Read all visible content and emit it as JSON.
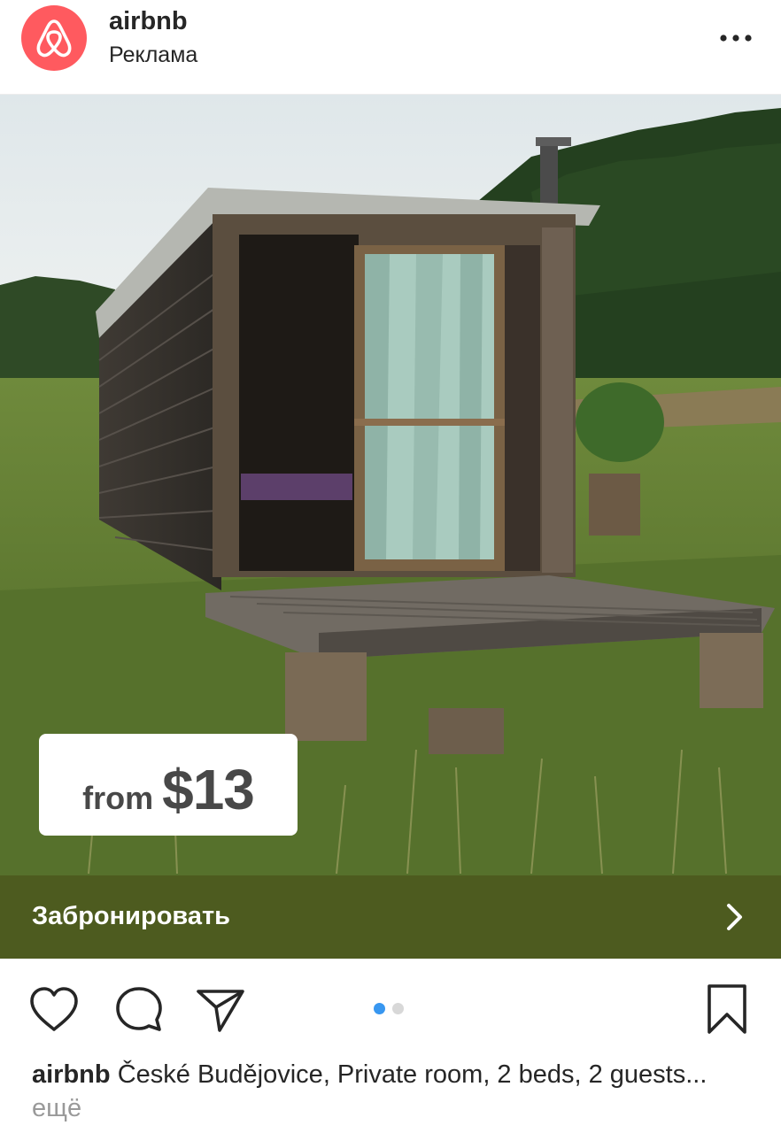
{
  "header": {
    "account_name": "airbnb",
    "sponsored_label": "Реклама",
    "avatar_icon": "airbnb-logo-icon",
    "more_icon": "more-options-icon",
    "brand_color": "#ff5a5f"
  },
  "post": {
    "price_prefix": "from",
    "price_value": "$13",
    "cta_label": "Забронировать",
    "cta_color": "#4d5b1f",
    "carousel": {
      "current": 1,
      "total": 2
    }
  },
  "actions": {
    "like_icon": "heart-icon",
    "comment_icon": "comment-icon",
    "share_icon": "send-icon",
    "save_icon": "bookmark-icon"
  },
  "caption": {
    "username": "airbnb",
    "text": "České Budějovice, Private room, 2 beds, 2 guests...",
    "more_label": "ещё"
  }
}
